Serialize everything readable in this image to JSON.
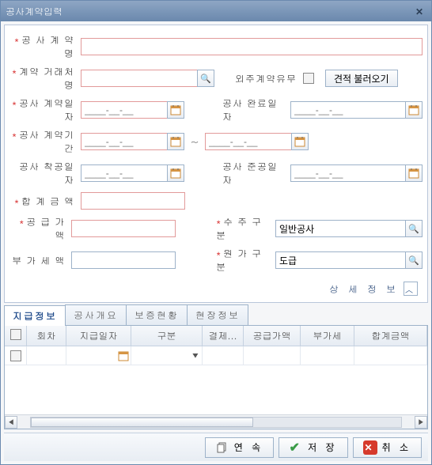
{
  "title": "공사계약입력",
  "fields": {
    "contract_name": {
      "label": "공 사 계 약 명",
      "required": true
    },
    "contract_partner": {
      "label": "계약 거래처명",
      "required": true
    },
    "outsource": {
      "label": "외주계약유무"
    },
    "load_quote_btn": "견적 불러오기",
    "contract_date": {
      "label": "공사 계약일자",
      "required": true,
      "placeholder": "____-__-__"
    },
    "complete_date": {
      "label": "공사 완료일자",
      "required": false,
      "placeholder": "____-__-__"
    },
    "contract_period": {
      "label": "공사 계약기간",
      "required": true,
      "placeholder": "____-__-__"
    },
    "contract_period_to": {
      "placeholder": "____-__-__"
    },
    "start_date": {
      "label": "공사 착공일자",
      "required": false,
      "placeholder": "____-__-__"
    },
    "finish_date": {
      "label": "공사 준공일자",
      "required": false,
      "placeholder": "____-__-__"
    },
    "total_amount": {
      "label": "합 계  금 액",
      "required": true
    },
    "supply_amount": {
      "label": "공 급  가 액",
      "required": true
    },
    "order_type": {
      "label": "수 주 구 분",
      "required": true,
      "value": "일반공사"
    },
    "vat_amount": {
      "label": "부 가  세 액",
      "required": false
    },
    "cost_type": {
      "label": "원 가 구 분",
      "required": true,
      "value": "도급"
    }
  },
  "detail_label": "상 세 정 보",
  "tabs": [
    "지급정보",
    "공사개요",
    "보증현황",
    "현장정보"
  ],
  "grid_columns": [
    "회차",
    "지급일자",
    "구분",
    "결제...",
    "공급가액",
    "부가세",
    "합계금액"
  ],
  "footer": {
    "continue": "연 속",
    "save": "저 장",
    "cancel": "취 소"
  }
}
